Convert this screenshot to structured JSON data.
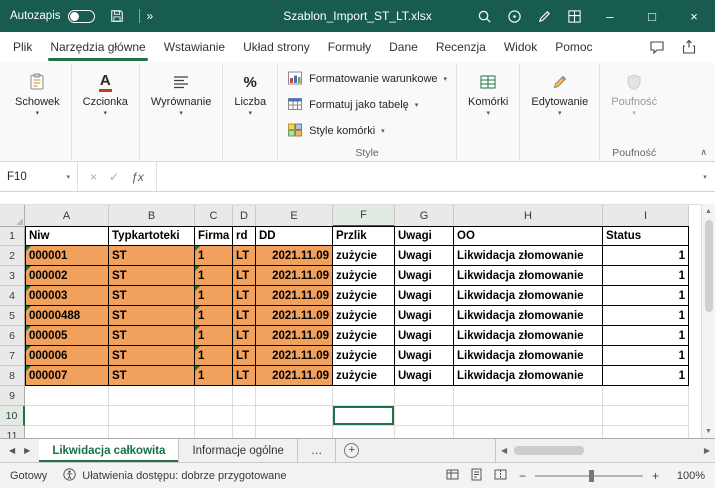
{
  "titlebar": {
    "autosave_label": "Autozapis",
    "title": "Szablon_Import_ST_LT.xlsx",
    "window_controls": {
      "minimize": "–",
      "maximize": "□",
      "close": "×"
    }
  },
  "ribbon": {
    "tabs": [
      {
        "label": "Plik",
        "active": false
      },
      {
        "label": "Narzędzia główne",
        "active": true
      },
      {
        "label": "Wstawianie",
        "active": false
      },
      {
        "label": "Układ strony",
        "active": false
      },
      {
        "label": "Formuły",
        "active": false
      },
      {
        "label": "Dane",
        "active": false
      },
      {
        "label": "Recenzja",
        "active": false
      },
      {
        "label": "Widok",
        "active": false
      },
      {
        "label": "Pomoc",
        "active": false
      }
    ],
    "groups": {
      "schowek": {
        "label": "Schowek"
      },
      "czcionka": {
        "label": "Czcionka"
      },
      "wyrownanie": {
        "label": "Wyrównanie"
      },
      "liczba": {
        "label": "Liczba"
      },
      "style": {
        "buttons": [
          "Formatowanie warunkowe",
          "Formatuj jako tabelę",
          "Style komórki"
        ],
        "label": "Style"
      },
      "komorki": {
        "label": "Komórki"
      },
      "edytowanie": {
        "label": "Edytowanie"
      },
      "poufnosc": {
        "label": "Poufność",
        "group_label": "Poufność"
      }
    }
  },
  "formula_bar": {
    "name_box": "F10",
    "cancel": "×",
    "enter": "✓",
    "fx": "ƒx",
    "value": ""
  },
  "grid": {
    "column_letters": [
      "A",
      "B",
      "C",
      "D",
      "E",
      "F",
      "G",
      "H",
      "I"
    ],
    "row_numbers": [
      "1",
      "2",
      "3",
      "4",
      "5",
      "6",
      "7",
      "8",
      "9",
      "10",
      "11"
    ],
    "header_row": [
      "Niw",
      "Typkartoteki",
      "Firma",
      "rd",
      "DD",
      "Przlik",
      "Uwagi",
      "OO",
      "Status"
    ],
    "data_rows": [
      [
        "000001",
        "ST",
        "1",
        "LT",
        "2021.11.09",
        "zużycie",
        "Uwagi",
        "Likwidacja złomowanie",
        "1"
      ],
      [
        "000002",
        "ST",
        "1",
        "LT",
        "2021.11.09",
        "zużycie",
        "Uwagi",
        "Likwidacja złomowanie",
        "1"
      ],
      [
        "000003",
        "ST",
        "1",
        "LT",
        "2021.11.09",
        "zużycie",
        "Uwagi",
        "Likwidacja złomowanie",
        "1"
      ],
      [
        "00000488",
        "ST",
        "1",
        "LT",
        "2021.11.09",
        "zużycie",
        "Uwagi",
        "Likwidacja złomowanie",
        "1"
      ],
      [
        "000005",
        "ST",
        "1",
        "LT",
        "2021.11.09",
        "zużycie",
        "Uwagi",
        "Likwidacja złomowanie",
        "1"
      ],
      [
        "000006",
        "ST",
        "1",
        "LT",
        "2021.11.09",
        "zużycie",
        "Uwagi",
        "Likwidacja złomowanie",
        "1"
      ],
      [
        "000007",
        "ST",
        "1",
        "LT",
        "2021.11.09",
        "zużycie",
        "Uwagi",
        "Likwidacja złomowanie",
        "1"
      ]
    ],
    "selected_cell": "F10"
  },
  "sheet_bar": {
    "tabs": [
      {
        "label": "Likwidacja całkowita",
        "active": true
      },
      {
        "label": "Informacje ogólne",
        "active": false
      },
      {
        "label": "…",
        "active": false
      }
    ],
    "add_label": "+"
  },
  "status_bar": {
    "mode": "Gotowy",
    "accessibility": "Ułatwienia dostępu: dobrze przygotowane",
    "zoom": "100%",
    "zoom_minus": "−",
    "zoom_plus": "+"
  },
  "icons": {
    "chevron_down": "▾",
    "more": "»",
    "left": "◀",
    "right": "▶",
    "up": "▲",
    "down": "▼",
    "collapse": "∧"
  },
  "colors": {
    "titlebar": "#185B4F",
    "accent_green": "#1F7246",
    "cell_fill_orange": "#F2A15C"
  }
}
